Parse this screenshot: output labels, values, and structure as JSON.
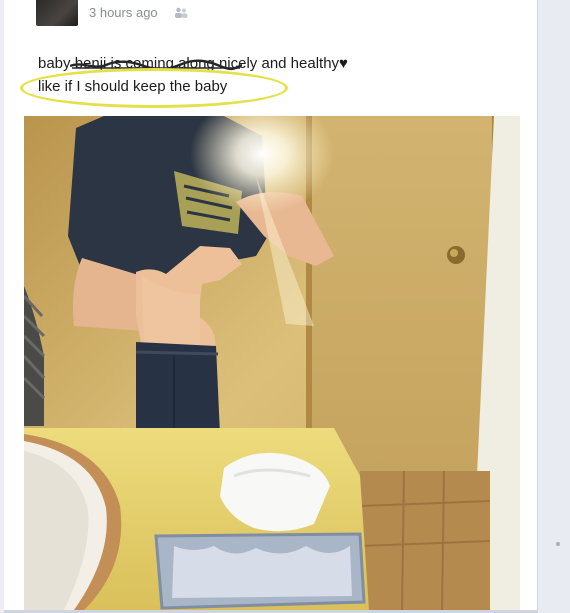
{
  "post": {
    "timestamp": "3 hours ago",
    "audience_icon": "friends-icon",
    "status_line1_prefix": "baby benji is coming along ",
    "status_line1_suffix": "nicely and healthy♥",
    "status_line2": "like if I should keep the baby",
    "photo_shirt_text": "star wars",
    "highlight_color": "#e3e14a"
  }
}
